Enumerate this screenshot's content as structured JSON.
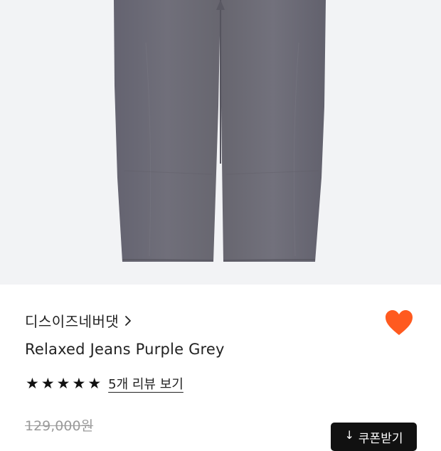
{
  "product_image": {
    "alt": "Relaxed Jeans Purple Grey",
    "background_color": "#f2f3f5",
    "garment_color": "#6b6a72"
  },
  "brand": {
    "name": "디스이즈네버댓",
    "arrow_icon": "chevron-right-icon"
  },
  "wishlist": {
    "icon": "heart-icon",
    "color": "#ff5a1f",
    "active": true
  },
  "product": {
    "name": "Relaxed Jeans Purple Grey"
  },
  "rating": {
    "stars": 5,
    "max_stars": 5,
    "review_link": "5개 리뷰 보기"
  },
  "price": {
    "original": "129,000원"
  },
  "coupon_button": {
    "label": "쿠폰받기",
    "icon": "download-arrow-icon",
    "icon_glyph": "↓"
  }
}
